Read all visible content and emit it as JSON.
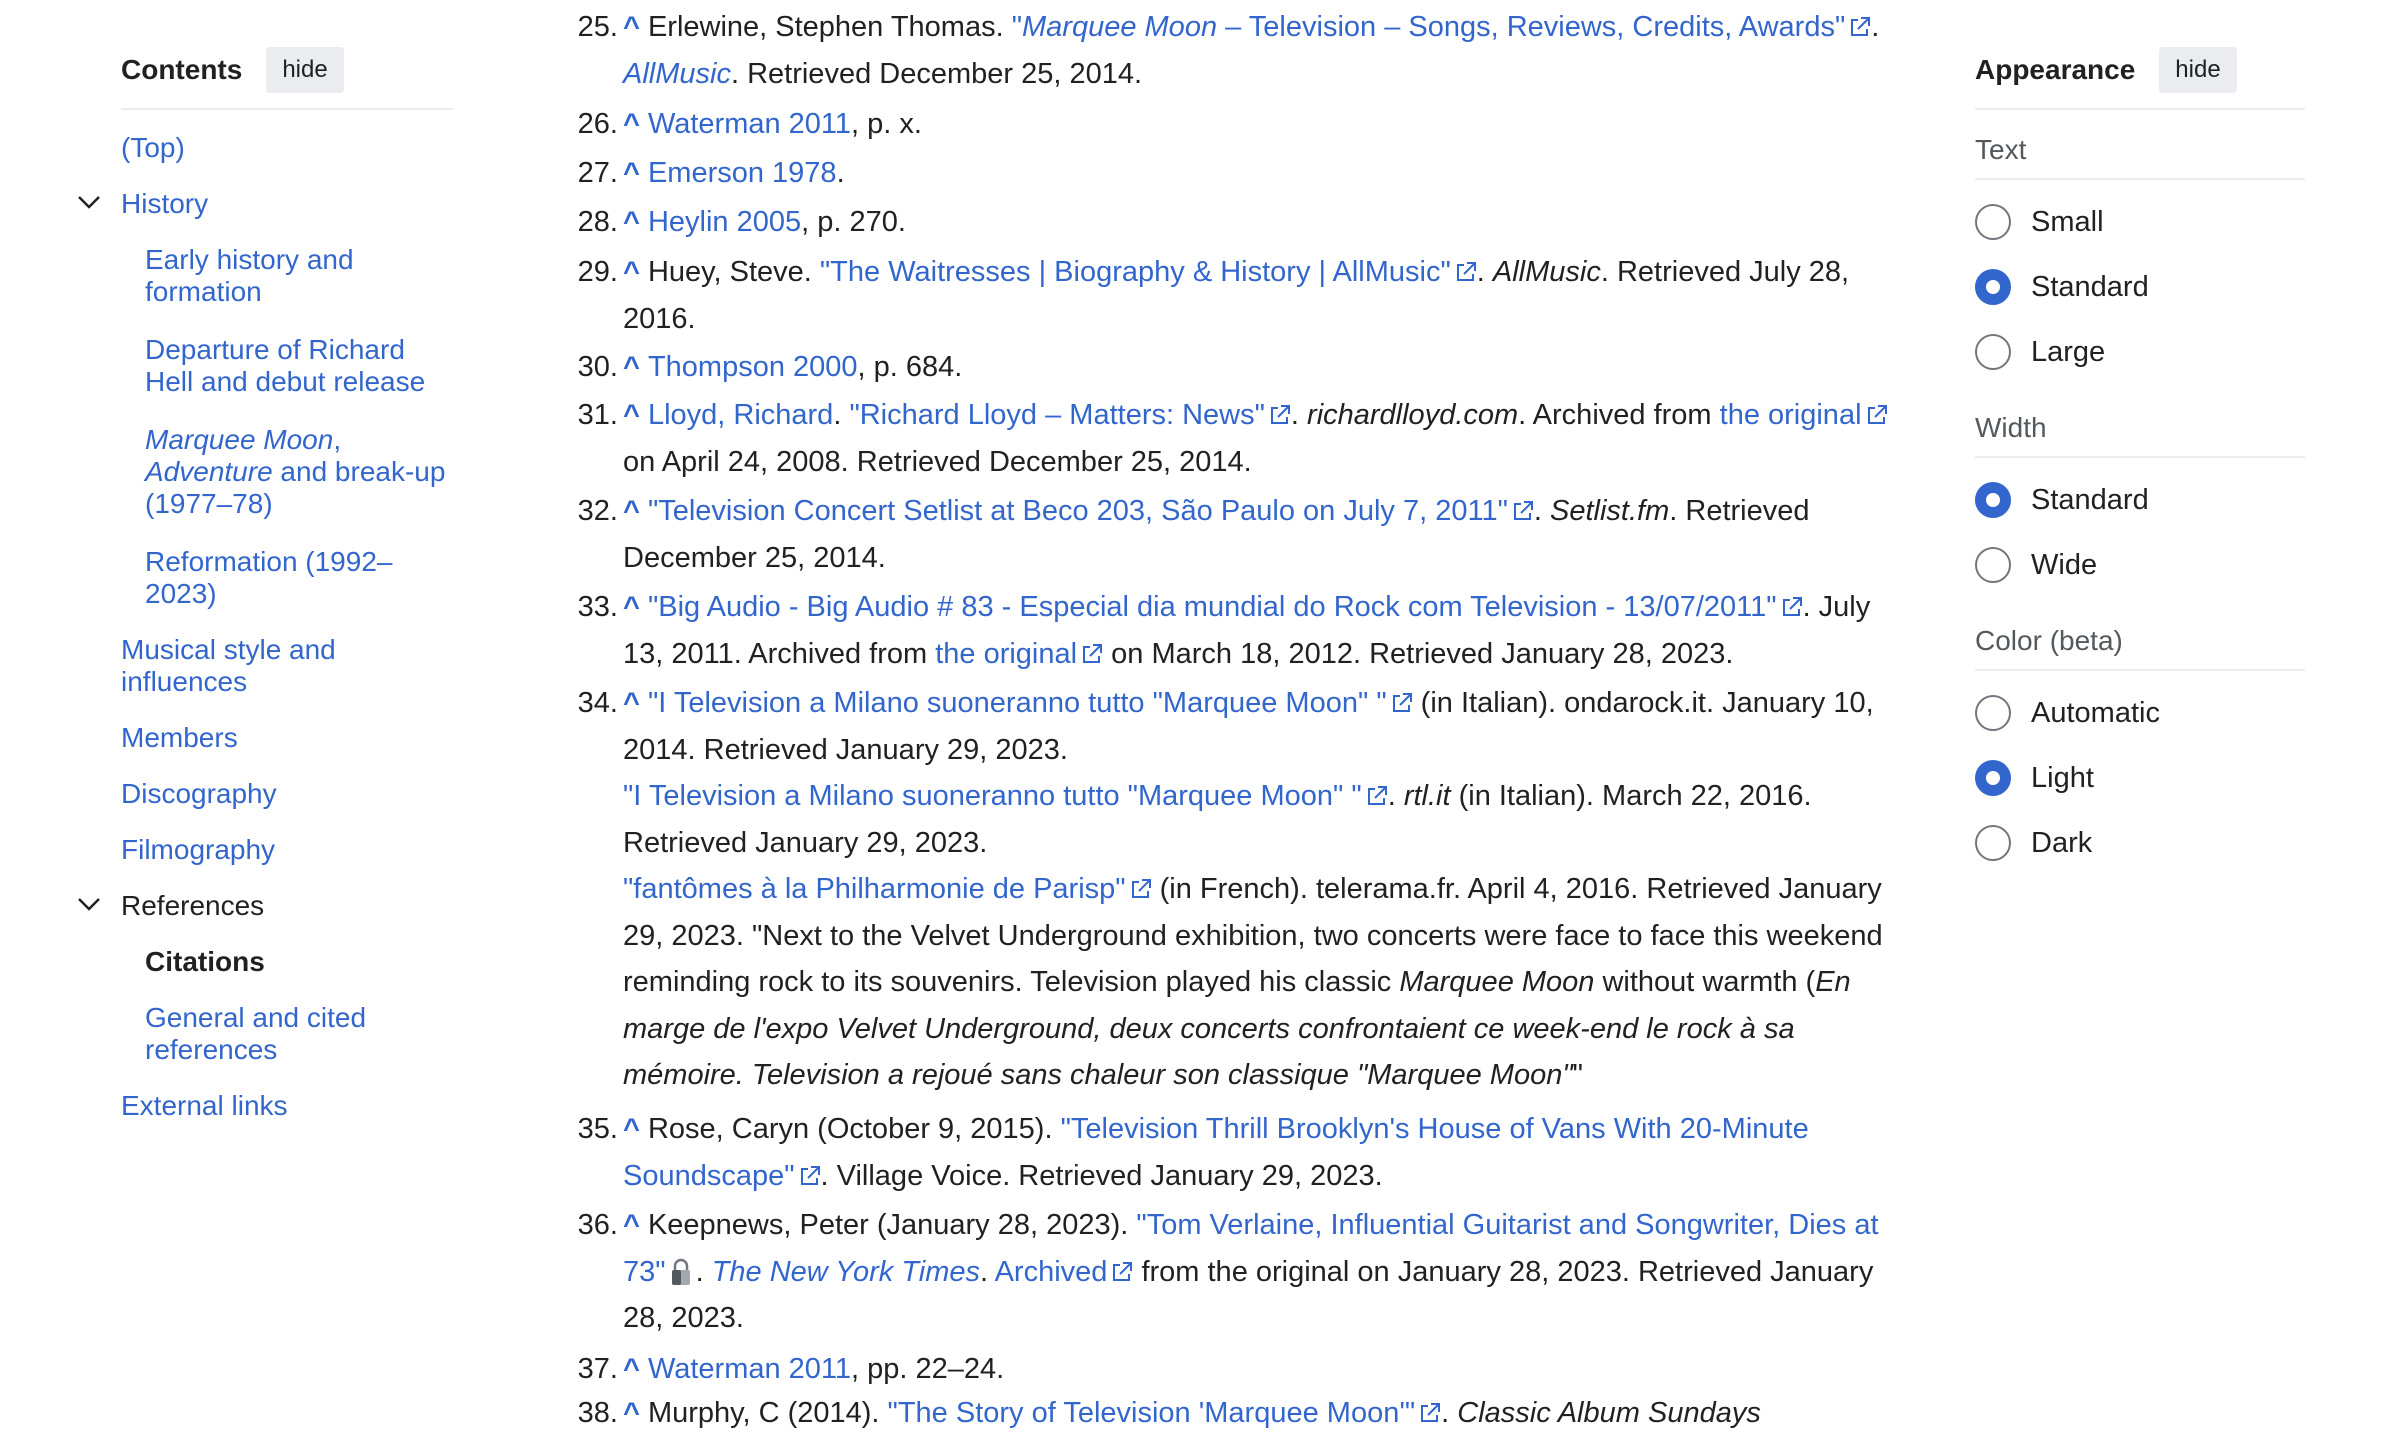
{
  "toc": {
    "title": "Contents",
    "hide_label": "hide",
    "items": [
      {
        "label": "(Top)"
      },
      {
        "label": "History"
      },
      {
        "label": "Early history and formation"
      },
      {
        "label": "Departure of Richard Hell and debut release"
      },
      {
        "label_a": "Marquee Moon",
        "label_b": ", ",
        "label_c": "Adventure",
        "label_d": " and break-up (1977–78)"
      },
      {
        "label": "Reformation (1992–2023)"
      },
      {
        "label": "Musical style and influences"
      },
      {
        "label": "Members"
      },
      {
        "label": "Discography"
      },
      {
        "label": "Filmography"
      },
      {
        "label": "References"
      },
      {
        "label": "Citations"
      },
      {
        "label": "General and cited references"
      },
      {
        "label": "External links"
      }
    ]
  },
  "refs": {
    "r25": {
      "num": "25.",
      "t1": "Erlewine, Stephen Thomas. ",
      "l1a": "\"",
      "l1b": "Marquee Moon",
      "l1c": " – Television – Songs, Reviews, Credits, Awards\"",
      "t2": ". ",
      "l2": "AllMusic",
      "t3": ". Retrieved December 25, 2014."
    },
    "r26": {
      "num": "26.",
      "l1": "Waterman 2011",
      "t1": ", p. x."
    },
    "r27": {
      "num": "27.",
      "l1": "Emerson 1978",
      "t1": "."
    },
    "r28": {
      "num": "28.",
      "l1": "Heylin 2005",
      "t1": ", p. 270."
    },
    "r29": {
      "num": "29.",
      "t1": "Huey, Steve. ",
      "l1": "\"The Waitresses | Biography & History | AllMusic\"",
      "t2": ". ",
      "i1": "AllMusic",
      "t3": ". Retrieved July 28, 2016."
    },
    "r30": {
      "num": "30.",
      "l1": "Thompson 2000",
      "t1": ", p. 684."
    },
    "r31": {
      "num": "31.",
      "l1": "Lloyd, Richard",
      "t1": ". ",
      "l2": "\"Richard Lloyd – Matters: News\"",
      "t2": ". ",
      "i1": "richardlloyd.com",
      "t3": ". Archived from ",
      "l3": "the original",
      "t4": " on April 24, 2008. Retrieved December 25, 2014."
    },
    "r32": {
      "num": "32.",
      "l1": "\"Television Concert Setlist at Beco 203, São Paulo on July 7, 2011\"",
      "t1": ". ",
      "i1": "Setlist.fm",
      "t2": ". Retrieved December 25, 2014."
    },
    "r33": {
      "num": "33.",
      "l1": "\"Big Audio - Big Audio # 83 - Especial dia mundial do Rock com Television - 13/07/2011\"",
      "t1": ". July 13, 2011. Archived from ",
      "l2": "the original",
      "t2": " on March 18, 2012. Retrieved January 28, 2023."
    },
    "r34": {
      "num": "34.",
      "l1": "\"I Television a Milano suoneranno tutto \"Marquee Moon\" \"",
      "t1": " (in Italian). ondarock.it. January 10, 2014. Retrieved January 29, 2023.",
      "l2": "\"I Television a Milano suoneranno tutto \"Marquee Moon\" \"",
      "t2": ". ",
      "i1": "rtl.it",
      "t3": " (in Italian). March 22, 2016. Retrieved January 29, 2023.",
      "l3": "\"fantômes à la Philharmonie de Parisp\"",
      "t4": " (in French). telerama.fr. April 4, 2016. Retrieved January 29, 2023. \"Next to the Velvet Underground exhibition, two concerts were face to face this weekend reminding rock to its souvenirs. Television played his classic ",
      "i2": "Marquee Moon",
      "t5": " without warmth (",
      "i3": "En marge de l'expo Velvet Underground, deux concerts confrontaient ce week-end le rock à sa mémoire. Television a rejoué sans chaleur son classique \"Marquee Moon\"",
      "t6": "\""
    },
    "r35": {
      "num": "35.",
      "t1": "Rose, Caryn (October 9, 2015). ",
      "l1": "\"Television Thrill Brooklyn's House of Vans With 20-Minute Soundscape\"",
      "t2": ". Village Voice. Retrieved January 29, 2023."
    },
    "r36": {
      "num": "36.",
      "t1": "Keepnews, Peter (January 28, 2023). ",
      "l1": "\"Tom Verlaine, Influential Guitarist and Songwriter, Dies at 73\"",
      "t2": ". ",
      "l2": "The New York Times",
      "t3": ". ",
      "l3": "Archived",
      "t4": " from the original on January 28, 2023. Retrieved January 28, 2023."
    },
    "r37": {
      "num": "37.",
      "l1": "Waterman 2011",
      "t1": ", pp. 22–24."
    },
    "r38": {
      "num": "38.",
      "t1": "Murphy, C (2014). ",
      "l1": "\"The Story of Television 'Marquee Moon'\"",
      "t2": ". ",
      "i1": "Classic Album Sundays"
    }
  },
  "appearance": {
    "title": "Appearance",
    "hide_label": "hide",
    "text_label": "Text",
    "text_options": [
      {
        "label": "Small",
        "checked": false
      },
      {
        "label": "Standard",
        "checked": true
      },
      {
        "label": "Large",
        "checked": false
      }
    ],
    "width_label": "Width",
    "width_options": [
      {
        "label": "Standard",
        "checked": true
      },
      {
        "label": "Wide",
        "checked": false
      }
    ],
    "color_label": "Color (beta)",
    "color_options": [
      {
        "label": "Automatic",
        "checked": false
      },
      {
        "label": "Light",
        "checked": true
      },
      {
        "label": "Dark",
        "checked": false
      }
    ]
  },
  "colors": {
    "link": "#3366cc",
    "text": "#202122",
    "accent": "#3366cc",
    "divider": "#eaecf0"
  }
}
